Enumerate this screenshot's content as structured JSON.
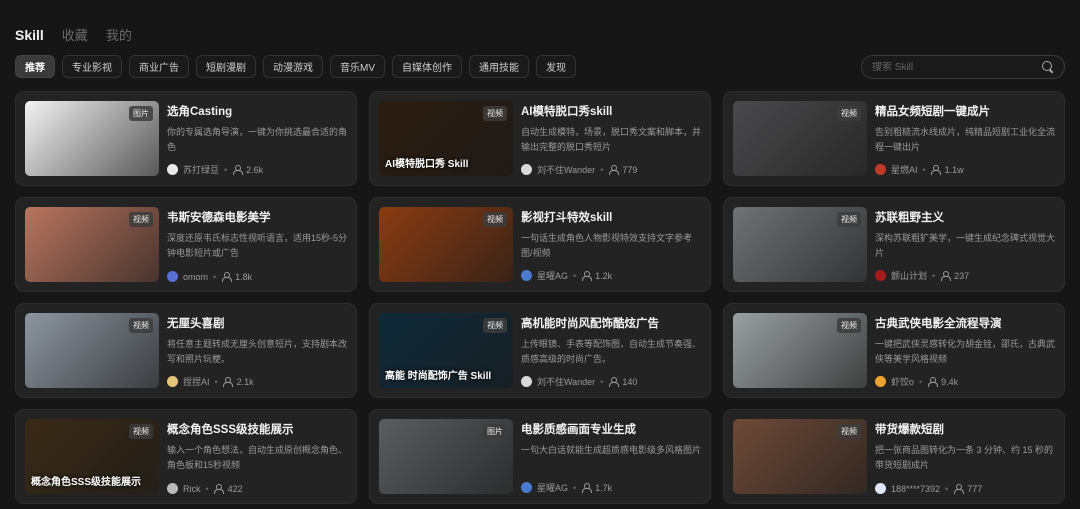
{
  "tabs": [
    {
      "label": "Skill",
      "active": true
    },
    {
      "label": "收藏",
      "active": false
    },
    {
      "label": "我的",
      "active": false
    }
  ],
  "filters": [
    {
      "label": "推荐",
      "active": true
    },
    {
      "label": "专业影视",
      "active": false
    },
    {
      "label": "商业广告",
      "active": false
    },
    {
      "label": "短剧漫剧",
      "active": false
    },
    {
      "label": "动漫游戏",
      "active": false
    },
    {
      "label": "音乐MV",
      "active": false
    },
    {
      "label": "自媒体创作",
      "active": false
    },
    {
      "label": "通用技能",
      "active": false
    },
    {
      "label": "发现",
      "active": false
    }
  ],
  "search": {
    "placeholder": "搜索 Skill",
    "icon": "search-icon"
  },
  "cards": [
    {
      "title": "选角Casting",
      "desc": "你的专属选角导演，一键为你挑选最合适的角色",
      "author": "苏打绿豆",
      "count": "2.6k",
      "badge": "图片",
      "overlay": "",
      "thumb_color": "#f3f3f3",
      "avatar_color": "#e9e9e9"
    },
    {
      "title": "AI模特脱口秀skill",
      "desc": "自动生成模特，场景，脱口秀文案和脚本，并输出完整的脱口秀短片",
      "author": "刘不住Wander",
      "count": "779",
      "badge": "视频",
      "overlay": "AI模特脱口秀 Skill",
      "thumb_color": "#2b1c10",
      "avatar_color": "#d9d9d9"
    },
    {
      "title": "精品女频短剧一键成片",
      "desc": "告别粗糙流水线成片，纯精品短剧工业化全流程一键出片",
      "author": "星燃AI",
      "count": "1.1w",
      "badge": "视频",
      "overlay": "",
      "thumb_color": "#4a4a4c",
      "avatar_color": "#c0392b"
    },
    {
      "title": "韦斯安德森电影美学",
      "desc": "深度还原韦氏标志性视听语言，适用15秒-5分钟电影短片或广告",
      "author": "omom",
      "count": "1.8k",
      "badge": "视频",
      "overlay": "",
      "thumb_color": "#b9755f",
      "avatar_color": "#5b6fd8"
    },
    {
      "title": "影视打斗特效skill",
      "desc": "一句话生成角色人物影视特效支持文字参考图/视频",
      "author": "星曜AG",
      "count": "1.2k",
      "badge": "视频",
      "overlay": "",
      "thumb_color": "#8a3b12",
      "avatar_color": "#4a7bd0"
    },
    {
      "title": "苏联粗野主义",
      "desc": "深构苏联粗犷美学，一键生成纪念碑式视觉大片",
      "author": "颤山计划",
      "count": "237",
      "badge": "视频",
      "overlay": "",
      "thumb_color": "#6f7375",
      "avatar_color": "#a51c1c"
    },
    {
      "title": "无厘头喜剧",
      "desc": "将任意主题转成无厘头创意短片，支持剧本改写和照片玩梗。",
      "author": "捏捏AI",
      "count": "2.1k",
      "badge": "视频",
      "overlay": "",
      "thumb_color": "#8d96a0",
      "avatar_color": "#e6c37a"
    },
    {
      "title": "高机能时尚风配饰酷炫广告",
      "desc": "上传眼镜、手表等配饰图，自动生成节奏强、质感高级的时尚广告。",
      "author": "刘不住Wander",
      "count": "140",
      "badge": "视频",
      "overlay": "高能 时尚配饰广告 Skill",
      "thumb_color": "#0f2a3a",
      "avatar_color": "#d9d9d9"
    },
    {
      "title": "古典武侠电影全流程导演",
      "desc": "一键把武侠灵感转化为胡金铨，邵氏，古典武侠等美学风格视频",
      "author": "虾饺o",
      "count": "9.4k",
      "badge": "视频",
      "overlay": "",
      "thumb_color": "#9aa0a0",
      "avatar_color": "#f0a030"
    },
    {
      "title": "概念角色SSS级技能展示",
      "desc": "输入一个角色想法，自动生成原创概念角色、角色板和15秒视频",
      "author": "Rick",
      "count": "422",
      "badge": "视频",
      "overlay": "概念角色SSS级技能展示",
      "thumb_color": "#3a2a16",
      "avatar_color": "#bbbbbb"
    },
    {
      "title": "电影质感画面专业生成",
      "desc": "一句大白话就能生成超质感电影级多风格图片",
      "author": "星曜AG",
      "count": "1.7k",
      "badge": "图片",
      "overlay": "",
      "thumb_color": "#5a5d5f",
      "avatar_color": "#4a7bd0"
    },
    {
      "title": "带货爆款短剧",
      "desc": "把一张商品图转化为一条 3 分钟、约 15 秒的带货短剧成片",
      "author": "188****7392",
      "count": "777",
      "badge": "视频",
      "overlay": "",
      "thumb_color": "#6e4a38",
      "avatar_color": "#dfe6ff"
    }
  ]
}
